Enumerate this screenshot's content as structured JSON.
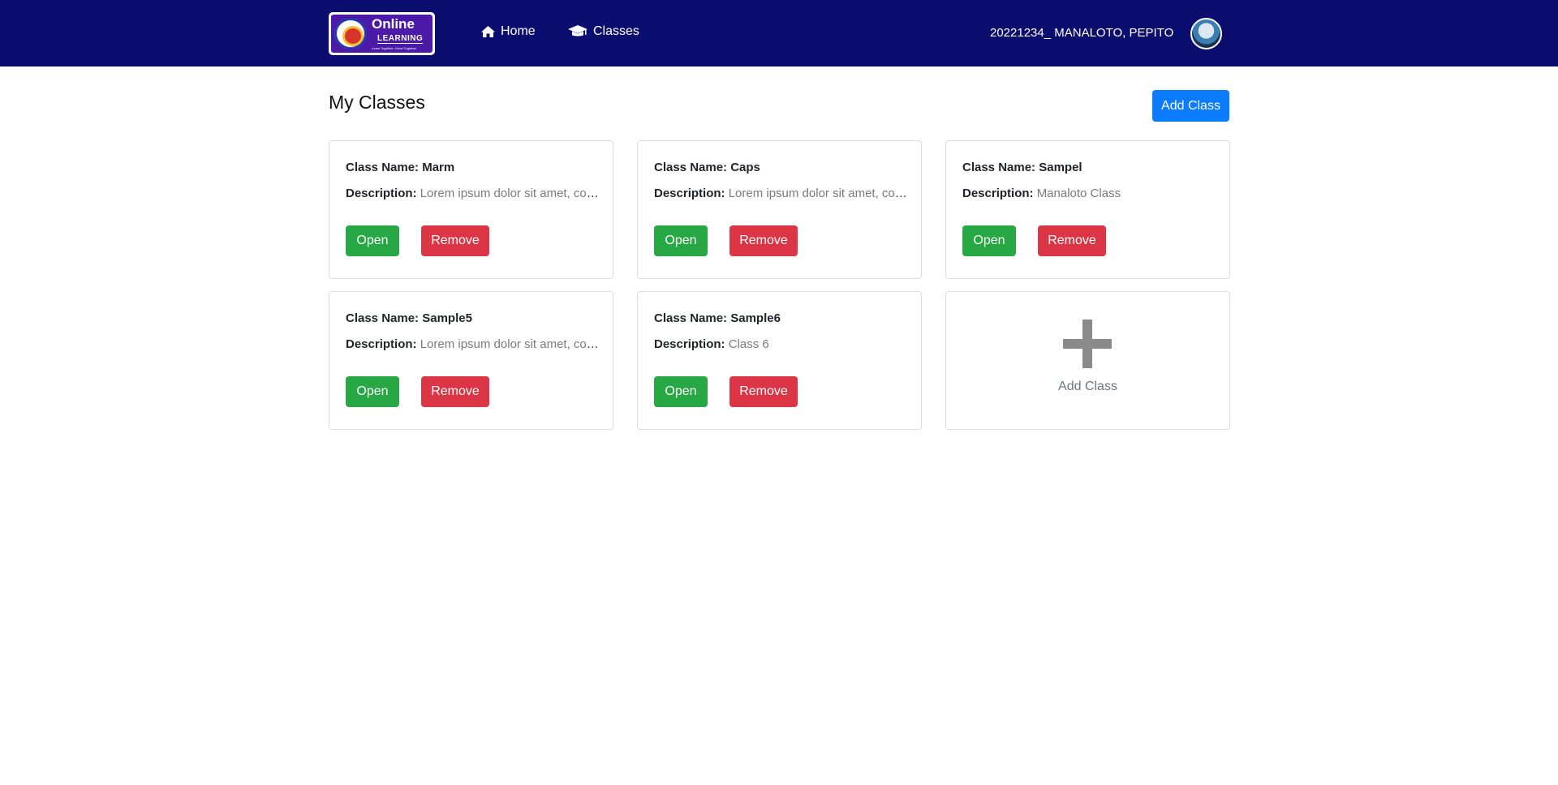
{
  "header": {
    "logo": {
      "line1": "Online",
      "line2": "LEARNING",
      "tagline": "Learn Together, Grow Together"
    },
    "nav": [
      {
        "label": "Home",
        "icon": "home-icon"
      },
      {
        "label": "Classes",
        "icon": "graduation-cap-icon"
      }
    ],
    "user_name": "20221234_ MANALOTO, PEPITO",
    "bg_color": "#0b0e6e"
  },
  "main": {
    "title": "My Classes",
    "add_class_button": "Add Class",
    "name_label": "Class Name: ",
    "desc_label": "Description: ",
    "open_label": "Open",
    "remove_label": "Remove",
    "classes": [
      {
        "name": "Marm",
        "description": "Lorem ipsum dolor sit amet, consectetur"
      },
      {
        "name": "Caps",
        "description": "Lorem ipsum dolor sit amet, consectetur"
      },
      {
        "name": "Sampel",
        "description": "Manaloto Class"
      },
      {
        "name": "Sample5",
        "description": "Lorem ipsum dolor sit amet, consectetur"
      },
      {
        "name": "Sample6",
        "description": "Class 6"
      }
    ],
    "add_card_label": "Add Class"
  },
  "colors": {
    "primary": "#0b7bff",
    "success": "#28a745",
    "danger": "#dc3545"
  }
}
